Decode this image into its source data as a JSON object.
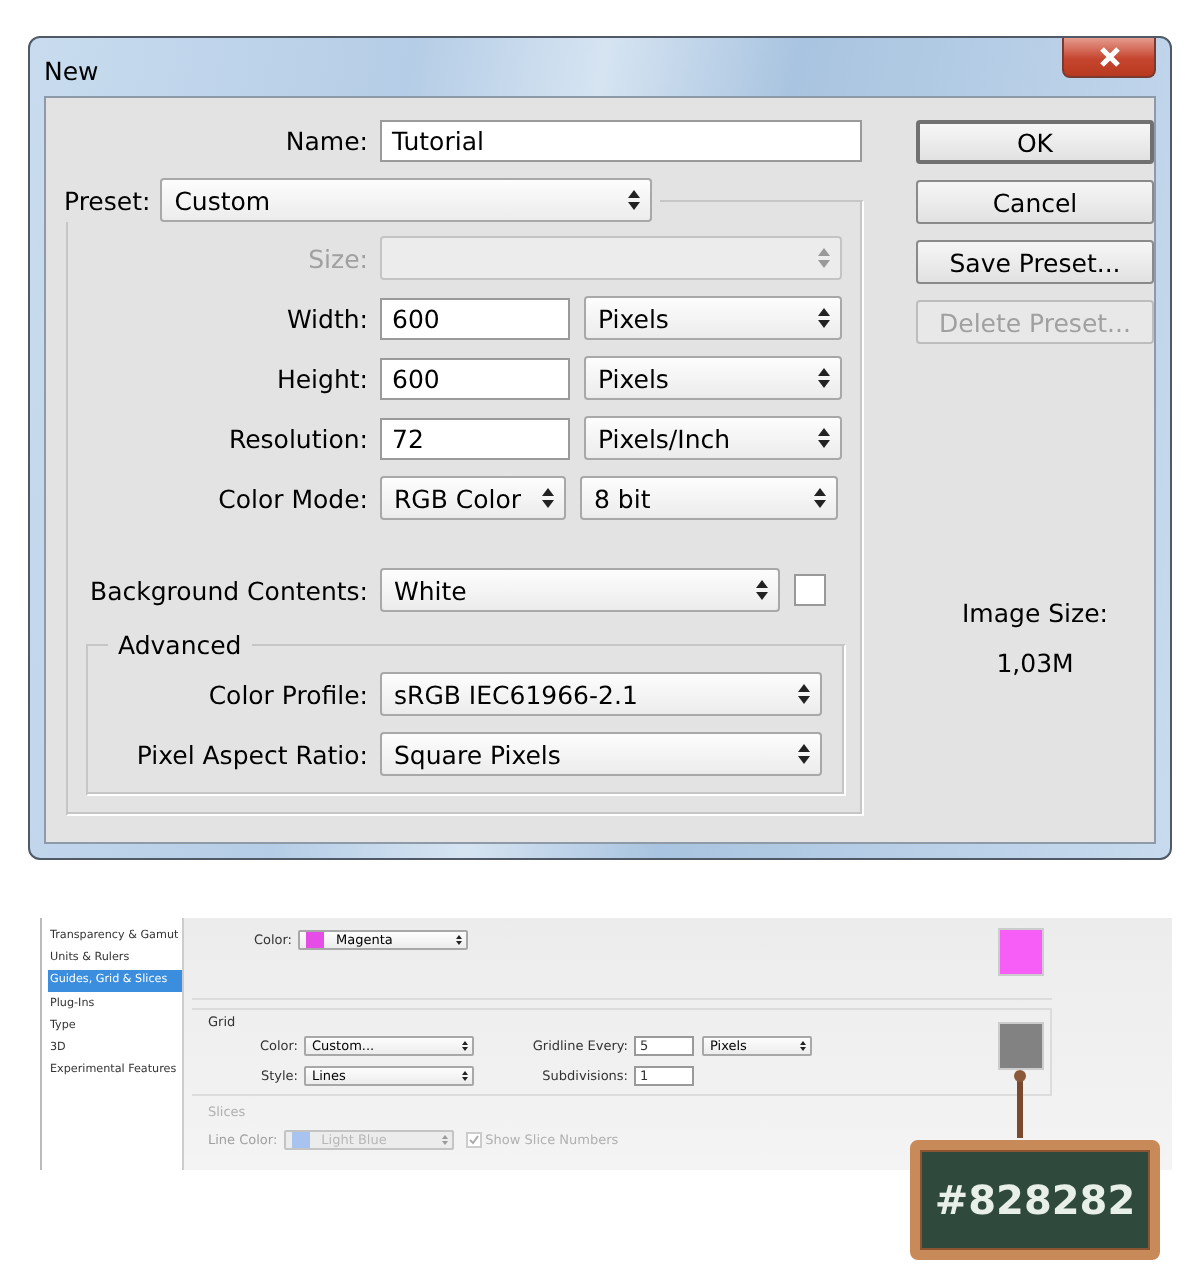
{
  "dialog": {
    "title": "New",
    "name": {
      "label": "Name:",
      "value": "Tutorial"
    },
    "preset": {
      "label": "Preset:",
      "value": "Custom"
    },
    "rows": [
      {
        "kind": "select",
        "label": "Size:",
        "disabled": true
      },
      {
        "kind": "number_unit",
        "label": "Width:",
        "value": "600",
        "unit": "Pixels",
        "disabled": false
      },
      {
        "kind": "number_unit",
        "label": "Height:",
        "value": "600",
        "unit": "Pixels",
        "disabled": false
      },
      {
        "kind": "number_unit",
        "label": "Resolution:",
        "value": "72",
        "unit": "Pixels/Inch",
        "disabled": false
      },
      {
        "kind": "select_pair",
        "label": "Color Mode:",
        "value": "RGB Color",
        "unit": "8 bit",
        "disabled": false
      },
      {
        "kind": "select_swatch",
        "label": "Background Contents:",
        "value": "White",
        "color": "#ffffff",
        "disabled": false
      }
    ],
    "advanced": {
      "legend": "Advanced",
      "rows": [
        {
          "kind": "select",
          "label": "Color Profile:",
          "value": "sRGB IEC61966-2.1",
          "disabled": false
        },
        {
          "kind": "select",
          "label": "Pixel Aspect Ratio:",
          "value": "Square Pixels",
          "disabled": false
        }
      ]
    },
    "buttons": [
      {
        "label": "OK",
        "default": true,
        "disabled": false
      },
      {
        "label": "Cancel",
        "default": false,
        "disabled": false
      },
      {
        "label": "Save Preset...",
        "default": false,
        "disabled": false
      },
      {
        "label": "Delete Preset...",
        "default": false,
        "disabled": true
      }
    ],
    "image_size": {
      "label": "Image Size:",
      "value": "1,03M"
    }
  },
  "preferences": {
    "sidebar": [
      {
        "label": "Transparency & Gamut",
        "selected": false
      },
      {
        "label": "Units & Rulers",
        "selected": false
      },
      {
        "label": "Guides, Grid & Slices",
        "selected": true
      },
      {
        "label": "Plug-Ins",
        "selected": false
      },
      {
        "label": "Type",
        "selected": false
      },
      {
        "label": "3D",
        "selected": false
      },
      {
        "label": "Experimental Features",
        "selected": false
      }
    ],
    "guides": {
      "rows": [
        {
          "kind": "select_color",
          "label": "Color:",
          "value": "Magenta",
          "color": "#e64ce6",
          "disabled": false
        }
      ],
      "color": "#f75ef7"
    },
    "grid": {
      "legend": "Grid",
      "color": "#828282",
      "left": [
        {
          "kind": "select",
          "label": "Color:",
          "value": "Custom...",
          "disabled": false
        },
        {
          "kind": "select",
          "label": "Style:",
          "value": "Lines",
          "disabled": false
        }
      ],
      "right": [
        {
          "kind": "number_unit",
          "label": "Gridline Every:",
          "value": "5",
          "unit": "Pixels",
          "disabled": false
        },
        {
          "kind": "number",
          "label": "Subdivisions:",
          "value": "1",
          "disabled": false
        }
      ]
    },
    "slices": {
      "legend": "Slices",
      "disabled": true,
      "rows": [
        {
          "kind": "select_color",
          "label": "Line Color:",
          "value": "Light Blue",
          "color": "#a8c4ee",
          "disabled": true
        }
      ],
      "show_numbers": {
        "label": "Show Slice Numbers",
        "checked": true
      }
    }
  },
  "sign": {
    "text": "#828282"
  }
}
